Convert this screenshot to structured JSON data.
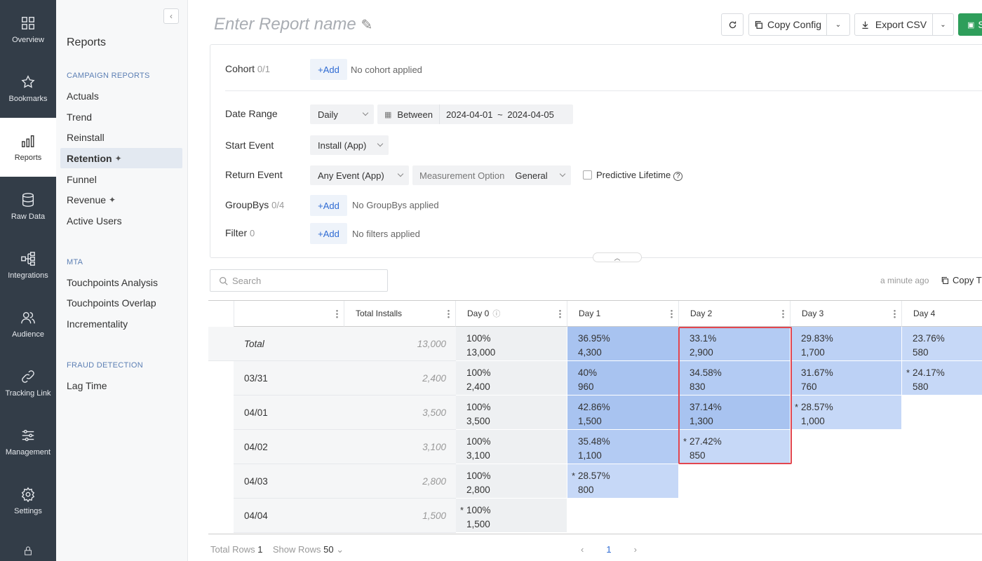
{
  "rail": [
    {
      "label": "Overview",
      "icon": "overview-icon"
    },
    {
      "label": "Bookmarks",
      "icon": "star-icon"
    },
    {
      "label": "Reports",
      "icon": "bar-chart-icon"
    },
    {
      "label": "Raw Data",
      "icon": "database-icon"
    },
    {
      "label": "Integrations",
      "icon": "flow-icon"
    },
    {
      "label": "Audience",
      "icon": "people-icon"
    },
    {
      "label": "Tracking Link",
      "icon": "link-icon"
    },
    {
      "label": "Management",
      "icon": "sliders-icon"
    },
    {
      "label": "Settings",
      "icon": "gear-icon"
    }
  ],
  "subnav": {
    "title": "Reports",
    "campaign_title": "CAMPAIGN REPORTS",
    "campaign_items": [
      "Actuals",
      "Trend",
      "Reinstall",
      "Retention",
      "Funnel",
      "Revenue",
      "Active Users"
    ],
    "mta_title": "MTA",
    "mta_items": [
      "Touchpoints Analysis",
      "Touchpoints Overlap",
      "Incrementality"
    ],
    "fraud_title": "FRAUD DETECTION",
    "fraud_items": [
      "Lag Time"
    ]
  },
  "toolbar": {
    "report_name_placeholder": "Enter Report name",
    "copy_config": "Copy Config",
    "export_csv": "Export CSV",
    "save": "S"
  },
  "filters": {
    "cohort_label": "Cohort",
    "cohort_count": "0/1",
    "add": "Add",
    "no_cohort": "No cohort applied",
    "date_range_label": "Date Range",
    "granularity": "Daily",
    "between": "Between",
    "date_from": "2024-04-01",
    "tilde": "~",
    "date_to": "2024-04-05",
    "start_event_label": "Start Event",
    "start_event": "Install (App)",
    "return_event_label": "Return Event",
    "return_event": "Any Event (App)",
    "measurement_label": "Measurement Option",
    "measurement": "General",
    "predictive": "Predictive Lifetime",
    "groupbys_label": "GroupBys",
    "groupbys_count": "0/4",
    "no_groupbys": "No GroupBys applied",
    "filter_label": "Filter",
    "filter_count": "0",
    "no_filters": "No filters applied"
  },
  "table": {
    "search_placeholder": "Search",
    "updated": "a minute ago",
    "copy_table": "Copy T",
    "headers": [
      "",
      "Total Installs",
      "Day 0",
      "Day 1",
      "Day 2",
      "Day 3",
      "Day 4"
    ],
    "total": {
      "label": "Total",
      "installs": "13,000",
      "cells": [
        [
          "100%",
          "13,000"
        ],
        [
          "36.95%",
          "4,300"
        ],
        [
          "33.1%",
          "2,900"
        ],
        [
          "29.83%",
          "1,700"
        ],
        [
          "23.76%",
          "580"
        ]
      ]
    },
    "rows": [
      {
        "date": "03/31",
        "installs": "2,400",
        "cells": [
          [
            "100%",
            "2,400"
          ],
          [
            "40%",
            "960"
          ],
          [
            "34.58%",
            "830"
          ],
          [
            "31.67%",
            "760"
          ],
          [
            "24.17%",
            "580"
          ]
        ]
      },
      {
        "date": "04/01",
        "installs": "3,500",
        "cells": [
          [
            "100%",
            "3,500"
          ],
          [
            "42.86%",
            "1,500"
          ],
          [
            "37.14%",
            "1,300"
          ],
          [
            "28.57%",
            "1,000"
          ]
        ]
      },
      {
        "date": "04/02",
        "installs": "3,100",
        "cells": [
          [
            "100%",
            "3,100"
          ],
          [
            "35.48%",
            "1,100"
          ],
          [
            "27.42%",
            "850"
          ]
        ]
      },
      {
        "date": "04/03",
        "installs": "2,800",
        "cells": [
          [
            "100%",
            "2,800"
          ],
          [
            "28.57%",
            "800"
          ]
        ]
      },
      {
        "date": "04/04",
        "installs": "1,500",
        "cells": [
          [
            "100%",
            "1,500"
          ]
        ]
      }
    ]
  },
  "footer": {
    "total_rows_label": "Total Rows",
    "total_rows": "1",
    "show_rows_label": "Show Rows",
    "show_rows": "50",
    "page": "1"
  }
}
